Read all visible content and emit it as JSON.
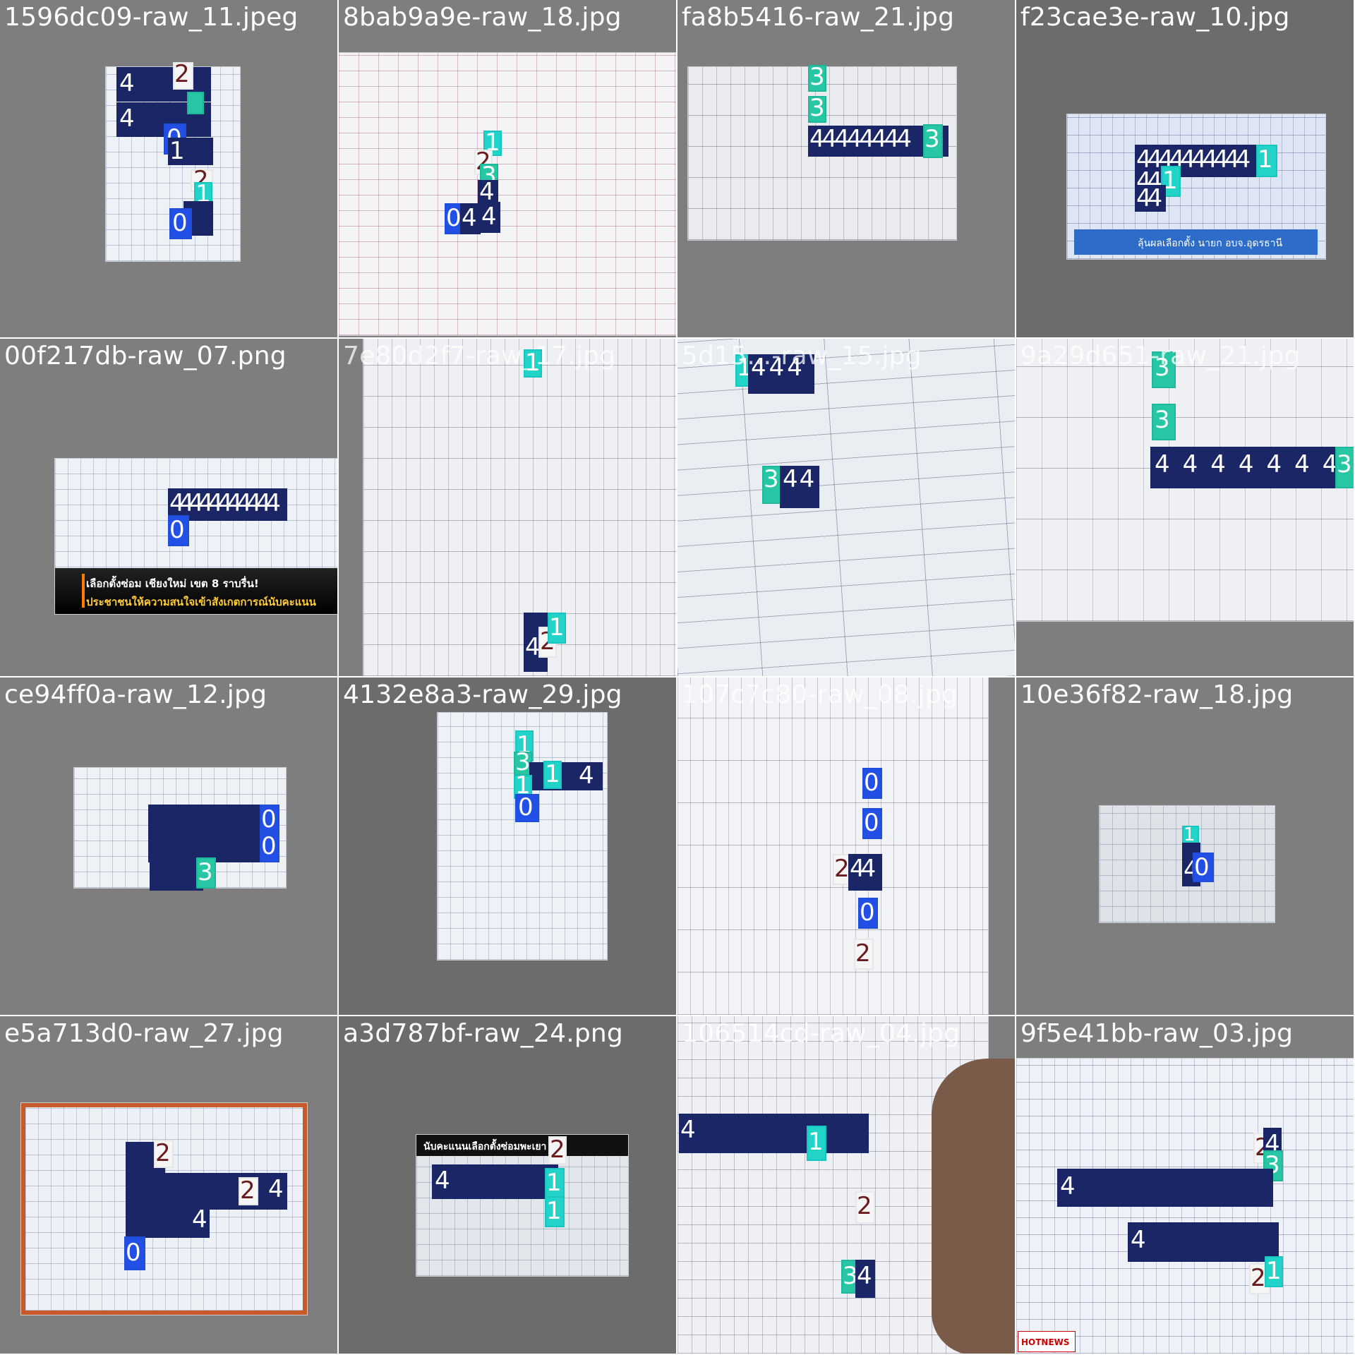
{
  "canvas": {
    "width": 1920,
    "height": 1920
  },
  "tiles": [
    {
      "label": "1596dc09-raw_11.jpeg"
    },
    {
      "label": "8bab9a9e-raw_18.jpg"
    },
    {
      "label": "fa8b5416-raw_21.jpg"
    },
    {
      "label": "f23cae3e-raw_10.jpg"
    },
    {
      "label": "00f217db-raw_07.png"
    },
    {
      "label": "7e80d2f7-raw_17.jpg"
    },
    {
      "label": "5d15...-raw_15.jpg"
    },
    {
      "label": "9a29d651-raw_21.jpg"
    },
    {
      "label": "ce94ff0a-raw_12.jpg"
    },
    {
      "label": "4132e8a3-raw_29.jpg"
    },
    {
      "label": "107c7c80-raw_08.jpg"
    },
    {
      "label": "10e36f82-raw_18.jpg"
    },
    {
      "label": "e5a713d0-raw_27.jpg"
    },
    {
      "label": "a3d787bf-raw_24.png"
    },
    {
      "label": "106514cd-raw_04.jpg"
    },
    {
      "label": "9f5e41bb-raw_03.jpg"
    }
  ],
  "overlays": {
    "t5_caption_line1": "เลือกตั้งซ่อม เชียงใหม่ เขต 8 ราบรื่น!",
    "t5_caption_line2": "ประชาชนให้ความสนใจเข้าสังเกตการณ์นับคะแนน",
    "t4_banner": "ลุ้นผลเลือกตั้ง นายก อบจ.อุดรธานี",
    "t14_banner": "นับคะแนนเลือกตั้งซ่อมพะเยา",
    "t16_logo": "HOTNEWS"
  },
  "detections": {
    "t1": [
      "2",
      "4",
      "2",
      "2",
      "4",
      "4",
      "0",
      "1",
      "2",
      "1",
      "0",
      "0"
    ],
    "t2": [
      "1",
      "2",
      "3",
      "4",
      "0",
      "4",
      "4"
    ],
    "t3": [
      "3",
      "3",
      "4",
      "4",
      "4",
      "4",
      "4",
      "4",
      "4",
      "4",
      "3"
    ],
    "t4": [
      "4",
      "4",
      "4",
      "4",
      "4",
      "4",
      "4",
      "4",
      "4",
      "4",
      "4",
      "1",
      "4",
      "4",
      "1",
      "4",
      "4"
    ],
    "t5": [
      "4",
      "4",
      "4",
      "4",
      "4",
      "4",
      "4",
      "4",
      "4",
      "4",
      "4",
      "0"
    ],
    "t6": [
      "1",
      "4",
      "4",
      "2",
      "1"
    ],
    "t7": [
      "1",
      "4",
      "4",
      "4",
      "3",
      "4",
      "4"
    ],
    "t8": [
      "3",
      "3",
      "4",
      "4",
      "4",
      "4",
      "4",
      "4",
      "4",
      "4",
      "3"
    ],
    "t9": [
      "0",
      "0",
      "3"
    ],
    "t10": [
      "1",
      "3",
      "1",
      "4",
      "1",
      "0"
    ],
    "t11": [
      "0",
      "0",
      "2",
      "4",
      "4",
      "0",
      "2"
    ],
    "t12": [
      "1",
      "4",
      "0"
    ],
    "t13": [
      "2",
      "4",
      "4",
      "2",
      "4",
      "0"
    ],
    "t14": [
      "2",
      "4",
      "1",
      "1"
    ],
    "t15": [
      "4",
      "1",
      "2",
      "3",
      "4"
    ],
    "t16": [
      "2",
      "4",
      "3",
      "4",
      "4",
      "2",
      "1"
    ]
  },
  "colors": {
    "tile_bg": "#7e7e7e",
    "tile_bg_alt": "#6c6c6c",
    "class_4_navy": "#1b2667",
    "class_1_cyan": "#22d3c8",
    "class_3_teal": "#27c6a4",
    "class_0_blue": "#2250e6",
    "class_2_white": "#f5f5f5"
  }
}
